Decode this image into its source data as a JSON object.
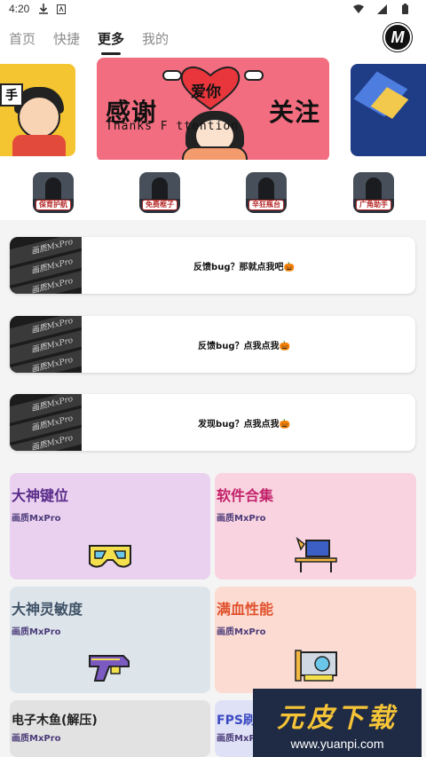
{
  "status_bar": {
    "time": "4:20"
  },
  "nav": {
    "tabs": [
      {
        "label": "首页",
        "active": false
      },
      {
        "label": "快捷",
        "active": false
      },
      {
        "label": "更多",
        "active": true
      },
      {
        "label": "我的",
        "active": false
      }
    ],
    "logo_text": "M"
  },
  "banner": {
    "left_tag": "手",
    "main_left": "感谢",
    "main_right": "关注",
    "main_heart": "爱你",
    "main_sub": "Thanks F         ttention"
  },
  "game_icons": [
    {
      "label": "保育护航"
    },
    {
      "label": "免费框子"
    },
    {
      "label": "辛狂瓶台"
    },
    {
      "label": "广角助手"
    }
  ],
  "feedback_cards": [
    {
      "thumb_text": "画质MxPro",
      "label": "反馈bug？那就点我吧🎃"
    },
    {
      "thumb_text": "画质MxPro",
      "label": "反馈bug？点我点我🎃"
    },
    {
      "thumb_text": "画质MxPro",
      "label": "发现bug？点我点我🎃"
    }
  ],
  "tiles": [
    {
      "title": "大神键位",
      "subtitle": "画质MxPro",
      "bg": "#ead1ef",
      "title_color": "#5a2c8a",
      "icon": "vr-glasses-icon"
    },
    {
      "title": "软件合集",
      "subtitle": "画质MxPro",
      "bg": "#f9d4e0",
      "title_color": "#c2216a",
      "icon": "desk-lamp-icon"
    },
    {
      "title": "大神灵敏度",
      "subtitle": "画质MxPro",
      "bg": "#dde4ea",
      "title_color": "#3f5266",
      "icon": "toy-gun-icon"
    },
    {
      "title": "满血性能",
      "subtitle": "画质MxPro",
      "bg": "#fcdcd2",
      "title_color": "#e0512d",
      "icon": "graphics-card-icon"
    },
    {
      "title": "电子木鱼(解压)",
      "subtitle": "画质MxPro",
      "bg": "#e2e2e2",
      "title_color": "#222222",
      "icon": ""
    },
    {
      "title": "FPS刷新",
      "subtitle": "画质MxPro",
      "bg": "#dfe2f6",
      "title_color": "#3c4ac2",
      "icon": ""
    }
  ],
  "watermark": {
    "title": "元皮下载",
    "url": "www.yuanpi.com"
  },
  "colors": {
    "accent": "#222222",
    "banner_pink": "#f26d7f",
    "banner_yellow": "#f4c531",
    "banner_blue": "#1f3c86",
    "watermark_bg": "#1f2a44",
    "watermark_gold": "#f6c437"
  }
}
